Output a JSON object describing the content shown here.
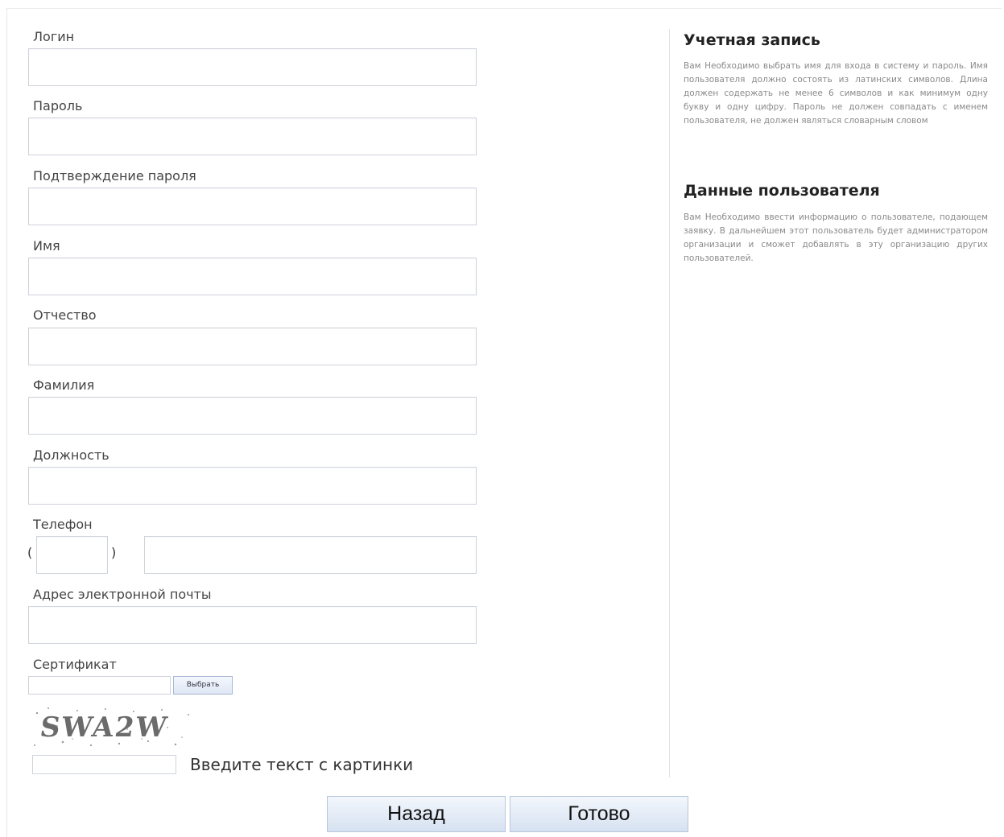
{
  "form": {
    "login_label": "Логин",
    "password_label": "Пароль",
    "confirm_password_label": "Подтверждение пароля",
    "first_name_label": "Имя",
    "middle_name_label": "Отчество",
    "last_name_label": "Фамилия",
    "position_label": "Должность",
    "phone_label": "Телефон",
    "phone_paren_open": "(",
    "phone_paren_close": ")",
    "email_label": "Адрес электронной почты",
    "certificate_label": "Сертификат",
    "choose_button": "Выбрать",
    "captcha_image_text": "SWA2W",
    "captcha_hint": "Введите текст с картинки"
  },
  "info": {
    "account_title": "Учетная запись",
    "account_text": "Вам Необходимо выбрать имя для входа в систему и пароль. Имя пользователя должно состоять из латинских символов. Длина должен содержать не менее 6 символов и как минимум одну букву и одну цифру. Пароль не должен совпадать с именем пользователя, не должен являться словарным словом",
    "user_title": "Данные пользователя",
    "user_text": "Вам Необходимо ввести информацию о пользователе, подающем заявку. В дальнейшем этот пользователь будет администратором организации и сможет добавлять в эту организацию других пользователей."
  },
  "footer": {
    "back_button": "Назад",
    "done_button": "Готово"
  }
}
